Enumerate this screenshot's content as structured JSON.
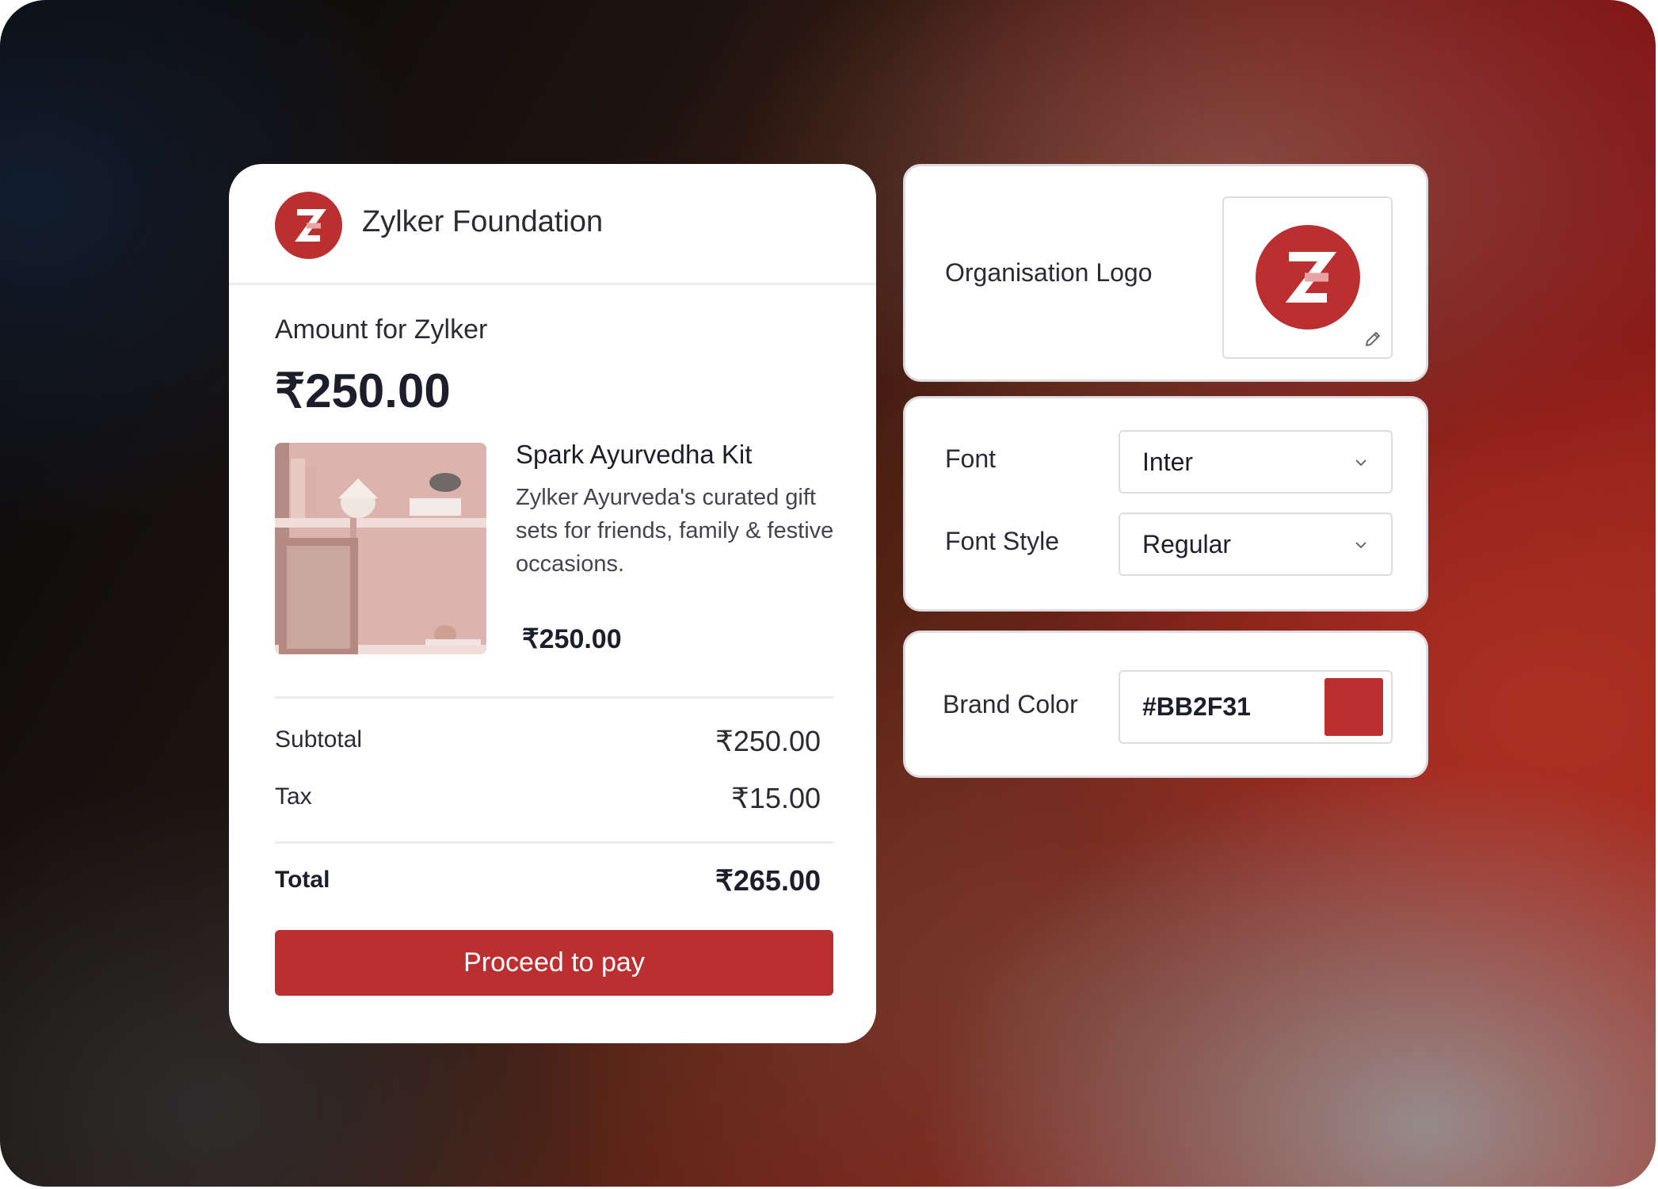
{
  "checkout": {
    "org_name": "Zylker Foundation",
    "amount_label": "Amount for Zylker",
    "amount_value": "₹250.00",
    "product": {
      "name": "Spark Ayurvedha Kit",
      "description": "Zylker  Ayurveda's curated gift sets for friends, family & festive occasions.",
      "price": "₹250.00"
    },
    "subtotal_label": "Subtotal",
    "subtotal_value": "₹250.00",
    "tax_label": "Tax",
    "tax_value": "₹15.00",
    "total_label": "Total",
    "total_value": "₹265.00",
    "pay_button": "Proceed to pay"
  },
  "settings": {
    "logo_label": "Organisation Logo",
    "font_label": "Font",
    "font_value": "Inter",
    "font_style_label": "Font Style",
    "font_style_value": "Regular",
    "brand_color_label": "Brand Color",
    "brand_color_value": "#BB2F31"
  },
  "colors": {
    "brand": "#BB2F31"
  },
  "icons": [
    "zylker-logo-icon",
    "edit-pencil-icon",
    "chevron-down-icon"
  ]
}
